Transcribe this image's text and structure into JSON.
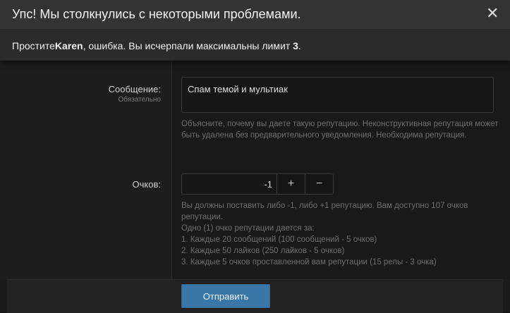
{
  "error_overlay": {
    "title": "Упс! Мы столкнулись с некоторыми проблемами.",
    "close_glyph": "✕",
    "message_prefix": "Простите",
    "username": "Karen",
    "message_middle": ", ошибка. Вы исчерпали максимальны лимит ",
    "limit": "3",
    "message_suffix": "."
  },
  "form": {
    "message": {
      "label": "Сообщение:",
      "required": "Обязательно",
      "value": "Спам темой и мультиак",
      "hint": "Объясните, почему вы даете такую репутацию. Неконструктивная репутация может быть удалена без предварительного уведомления. Необходима репутация."
    },
    "points": {
      "label": "Очков:",
      "value": "-1",
      "plus_glyph": "+",
      "minus_glyph": "−",
      "hint_lines": [
        "Вы должны поставить либо -1, либо +1 репутацию. Вам доступно 107 очков репутации.",
        "Одно (1) очко репутации дается за:",
        "1. Каждые 20 сообщений (100 сообщений - 5 очков)",
        "2. Каждые 50 лайков (250 лайков - 5 очков)",
        "3. Каждые 5 очков проставленной вам репутации (15 репы - 3 очка)"
      ]
    },
    "submit_label": "Отправить"
  },
  "colors": {
    "accent": "#3b77a6",
    "background": "#141414",
    "overlay": "#2b2b2b"
  }
}
